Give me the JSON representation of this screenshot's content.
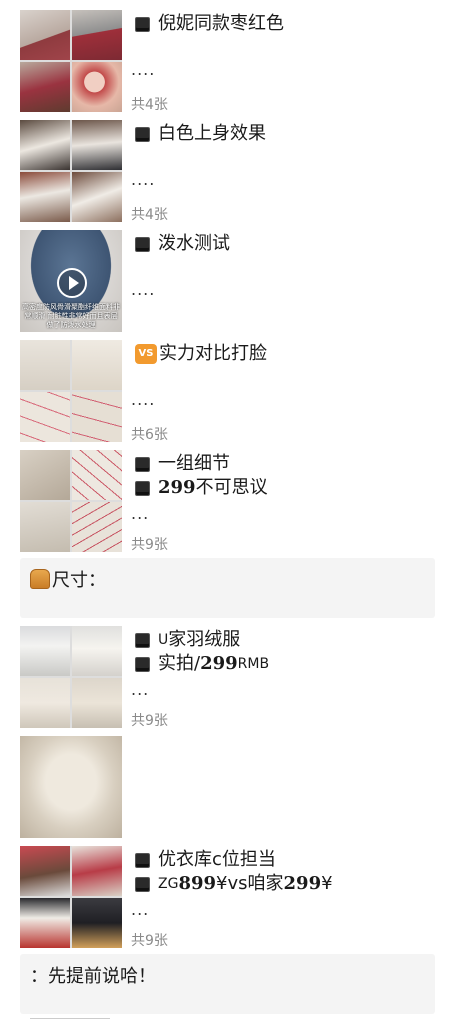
{
  "posts": [
    {
      "lines": [
        "倪妮同款枣红色"
      ],
      "ellipsis": "....",
      "count": "共4张",
      "thumb_type": "grid",
      "icon": "black-square-icon"
    },
    {
      "lines": [
        "白色上身效果"
      ],
      "ellipsis": "....",
      "count": "共4张",
      "thumb_type": "grid",
      "icon": "black-square-icon"
    },
    {
      "lines": [
        "泼水测试"
      ],
      "ellipsis": "....",
      "thumb_type": "video",
      "video_caption": "高密度防风骨滑聚酯纤维面料非常顺滑 耐脏性非常好而且表层做了防泼水处理",
      "icon": "black-square-icon"
    },
    {
      "lines": [
        "实力对比打脸"
      ],
      "ellipsis": "....",
      "count": "共6张",
      "thumb_type": "grid",
      "icon": "vs-badge-icon",
      "badge": "VS"
    },
    {
      "line1": "一组细节",
      "line2_bold": "299",
      "line2_rest": "不可思议",
      "ellipsis": "...",
      "count": "共9张",
      "thumb_type": "grid",
      "icon": "black-square-icon"
    }
  ],
  "size_notice": {
    "label": "尺寸：",
    "icon": "bread-icon"
  },
  "posts2": [
    {
      "line1_prefix": "U",
      "line1_rest": "家羽绒服",
      "line2_prefix": "实拍/",
      "line2_bold": "299",
      "line2_suffix": "RMB",
      "ellipsis": "...",
      "count": "共9张"
    },
    {
      "thumb_type": "single"
    },
    {
      "line1": "优衣库c位担当",
      "line2_prefix": "ZG",
      "line2_bold1": "899",
      "line2_yen1": "¥",
      "line2_mid": "vs咱家",
      "line2_bold2": "299",
      "line2_yen2": "¥",
      "ellipsis": "...",
      "count": "共9张"
    }
  ],
  "bottom_notice": {
    "text": "：先提前说哈！"
  }
}
